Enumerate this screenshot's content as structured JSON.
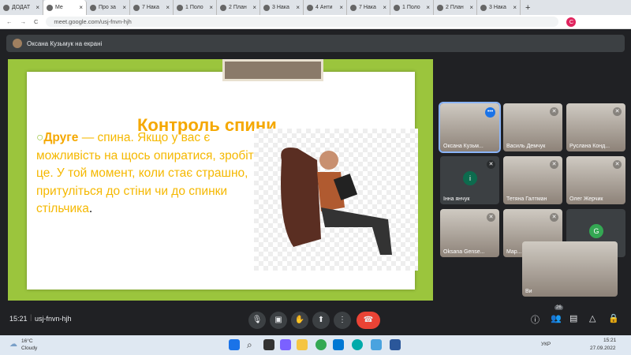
{
  "browser": {
    "tabs": [
      {
        "label": "ДОДАТ"
      },
      {
        "label": "Ме",
        "active": true
      },
      {
        "label": "Про за"
      },
      {
        "label": "7 Нака"
      },
      {
        "label": "1 Поло"
      },
      {
        "label": "2 План"
      },
      {
        "label": "3 Нака"
      },
      {
        "label": "4 Анти"
      },
      {
        "label": "7 Нака"
      },
      {
        "label": "1 Поло"
      },
      {
        "label": "2 План"
      },
      {
        "label": "3 Нака"
      }
    ],
    "new_tab": "+",
    "url": "meet.google.com/usj-fnvn-hjh",
    "profile_initial": "C"
  },
  "banner": {
    "text": "Оксана Кузьмук на екрані"
  },
  "slide": {
    "title": "Контроль спини",
    "body_bold": "Друге",
    "body": " — спина. Якщо у вас є можливість на щось опиратися, зробіть це. У той момент, коли стає страшно, притуліться до стіни чи до спинки стільчика",
    "period": "."
  },
  "participants": [
    {
      "name": "Оксана Кузьм..."
    },
    {
      "name": "Василь Демчук"
    },
    {
      "name": "Руслана Конд..."
    },
    {
      "name": "Інна янчук",
      "initial": "і"
    },
    {
      "name": "Тетяна Галтман"
    },
    {
      "name": "Олег Жерчик"
    },
    {
      "name": "Oksana Gense..."
    },
    {
      "name": "Мар..."
    },
    {
      "name": "Ще 16 осіб",
      "initial": "G"
    }
  ],
  "self": {
    "name": "Ви"
  },
  "meeting": {
    "time": "15:21",
    "code": "usj-fnvn-hjh",
    "people_count": "26"
  },
  "taskbar": {
    "temp": "16°C",
    "weather": "Cloudy",
    "lang": "УКР",
    "time": "15:21",
    "date": "27.09.2022"
  },
  "colors": {
    "slide_border": "#9bc53d",
    "title": "#f5a800",
    "end_call": "#ea4335"
  }
}
